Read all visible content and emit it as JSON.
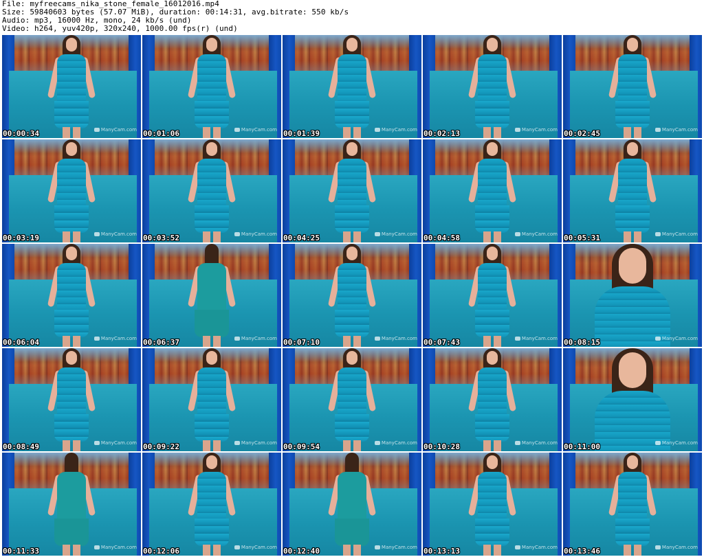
{
  "header": {
    "file_line": "File: myfreecams_nika_stone_female_16012016.mp4",
    "size_line": "Size: 59840603 bytes (57.07 MiB), duration: 00:14:31, avg.bitrate: 550 kb/s",
    "audio_line": "Audio: mp3, 16000 Hz, mono, 24 kb/s (und)",
    "video_line": "Video: h264, yuv420p, 320x240, 1000.00 fps(r) (und)"
  },
  "thumbnails": [
    {
      "timestamp": "00:00:34",
      "watermark": "ManyCam.com",
      "variant": "standard"
    },
    {
      "timestamp": "00:01:06",
      "watermark": "ManyCam.com",
      "variant": "standard"
    },
    {
      "timestamp": "00:01:39",
      "watermark": "ManyCam.com",
      "variant": "standard"
    },
    {
      "timestamp": "00:02:13",
      "watermark": "ManyCam.com",
      "variant": "standard"
    },
    {
      "timestamp": "00:02:45",
      "watermark": "ManyCam.com",
      "variant": "standard"
    },
    {
      "timestamp": "00:03:19",
      "watermark": "ManyCam.com",
      "variant": "standard"
    },
    {
      "timestamp": "00:03:52",
      "watermark": "ManyCam.com",
      "variant": "standard"
    },
    {
      "timestamp": "00:04:25",
      "watermark": "ManyCam.com",
      "variant": "standard"
    },
    {
      "timestamp": "00:04:58",
      "watermark": "ManyCam.com",
      "variant": "standard"
    },
    {
      "timestamp": "00:05:31",
      "watermark": "ManyCam.com",
      "variant": "standard"
    },
    {
      "timestamp": "00:06:04",
      "watermark": "ManyCam.com",
      "variant": "standard"
    },
    {
      "timestamp": "00:06:37",
      "watermark": "ManyCam.com",
      "variant": "plain"
    },
    {
      "timestamp": "00:07:10",
      "watermark": "ManyCam.com",
      "variant": "standard"
    },
    {
      "timestamp": "00:07:43",
      "watermark": "ManyCam.com",
      "variant": "standard"
    },
    {
      "timestamp": "00:08:15",
      "watermark": "ManyCam.com",
      "variant": "closeup"
    },
    {
      "timestamp": "00:08:49",
      "watermark": "ManyCam.com",
      "variant": "standard"
    },
    {
      "timestamp": "00:09:22",
      "watermark": "ManyCam.com",
      "variant": "standard"
    },
    {
      "timestamp": "00:09:54",
      "watermark": "ManyCam.com",
      "variant": "standard"
    },
    {
      "timestamp": "00:10:28",
      "watermark": "ManyCam.com",
      "variant": "standard"
    },
    {
      "timestamp": "00:11:00",
      "watermark": "ManyCam.com",
      "variant": "closeup"
    },
    {
      "timestamp": "00:11:33",
      "watermark": "ManyCam.com",
      "variant": "plain"
    },
    {
      "timestamp": "00:12:06",
      "watermark": "ManyCam.com",
      "variant": "standard"
    },
    {
      "timestamp": "00:12:40",
      "watermark": "ManyCam.com",
      "variant": "plain"
    },
    {
      "timestamp": "00:13:13",
      "watermark": "ManyCam.com",
      "variant": "standard"
    },
    {
      "timestamp": "00:13:46",
      "watermark": "ManyCam.com",
      "variant": "standard"
    }
  ],
  "colors": {
    "background": "#ffffff",
    "header_text": "#000000",
    "timestamp_text": "#ffffff",
    "timestamp_outline": "#000000",
    "curtain": "#1656c4",
    "couch": "#1b95b1",
    "dress": "#18a0c4"
  }
}
